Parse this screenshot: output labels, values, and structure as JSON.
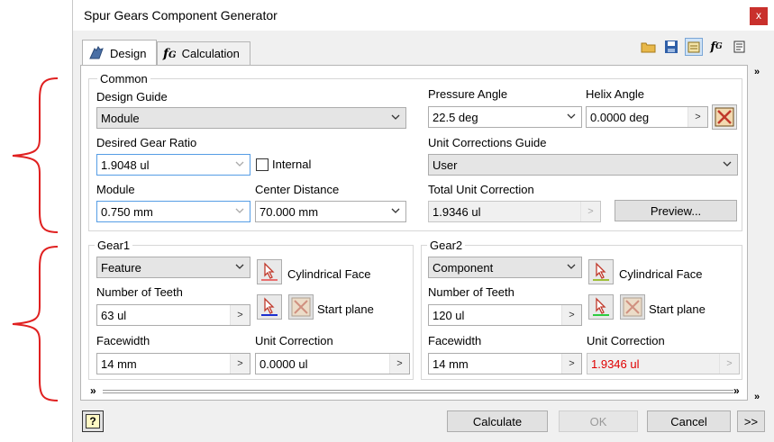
{
  "window": {
    "title": "Spur Gears Component Generator",
    "close_glyph": "x"
  },
  "tabs": [
    {
      "label": "Design",
      "icon": "design-gear-icon"
    },
    {
      "label": "Calculation",
      "icon": "fx-calc-icon"
    }
  ],
  "toolbar_icons": [
    "open-folder-icon",
    "save-icon",
    "options-icon",
    "fx-icon",
    "notes-icon"
  ],
  "common": {
    "legend": "Common",
    "design_guide": {
      "label": "Design Guide",
      "value": "Module"
    },
    "desired_gear_ratio": {
      "label": "Desired Gear Ratio",
      "value": "1.9048 ul"
    },
    "internal": {
      "label": "Internal",
      "checked": false
    },
    "module": {
      "label": "Module",
      "value": "0.750 mm"
    },
    "center_distance": {
      "label": "Center Distance",
      "value": "70.000 mm"
    },
    "pressure_angle": {
      "label": "Pressure Angle",
      "value": "22.5 deg"
    },
    "helix_angle": {
      "label": "Helix Angle",
      "value": "0.0000 deg"
    },
    "unit_corrections_guide": {
      "label": "Unit Corrections Guide",
      "value": "User"
    },
    "total_unit_correction": {
      "label": "Total Unit Correction",
      "value": "1.9346 ul"
    },
    "preview_button": "Preview..."
  },
  "gear1": {
    "legend": "Gear1",
    "type": "Feature",
    "cylindrical_face": "Cylindrical Face",
    "start_plane": "Start plane",
    "teeth": {
      "label": "Number of Teeth",
      "value": "63 ul"
    },
    "facewidth": {
      "label": "Facewidth",
      "value": "14 mm"
    },
    "unit_correction": {
      "label": "Unit Correction",
      "value": "0.0000 ul"
    }
  },
  "gear2": {
    "legend": "Gear2",
    "type": "Component",
    "cylindrical_face": "Cylindrical Face",
    "start_plane": "Start plane",
    "teeth": {
      "label": "Number of Teeth",
      "value": "120 ul"
    },
    "facewidth": {
      "label": "Facewidth",
      "value": "14 mm"
    },
    "unit_correction": {
      "label": "Unit Correction",
      "value": "1.9346 ul",
      "color": "#e00000"
    }
  },
  "footer": {
    "help_glyph": "?",
    "calculate": "Calculate",
    "ok": "OK",
    "cancel": "Cancel",
    "more": ">>"
  },
  "glyphs": {
    "chevron_right": ">",
    "expand_down": "»",
    "expand_right": "»"
  },
  "colors": {
    "annotation_brace": "#e02020",
    "close_button": "#c9302c",
    "error_text": "#e00000"
  }
}
